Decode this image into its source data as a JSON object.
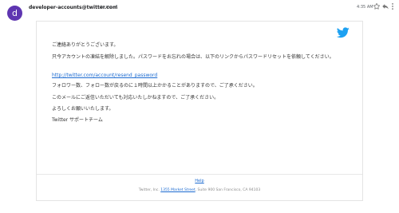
{
  "header": {
    "avatar_letter": "d",
    "sender": "developer-accounts@twitter.com",
    "to": "to me",
    "time": "4:35 AM"
  },
  "icons": {
    "avatar_color": "#5e35b1",
    "brand_bird": "twitter-bird-icon",
    "star": "star-icon",
    "reply": "reply-icon",
    "more": "more-vert-icon"
  },
  "message": {
    "greeting": "ご連絡ありがとうございます。",
    "paragraph1": "只今アカウントの凍結を解除しました。パスワードをお忘れの場合は、以下のリンクからパスワードリセットを依頼してください。",
    "reset_link": "http://twitter.com/account/resend_password",
    "paragraph2": "フォロワー数、フォロー数が戻るのに１時間以上かかることがありますので、ご了承ください。",
    "paragraph3": "このメールにご返信いただいても対応いたしかねますので、ご了承ください。",
    "closing": "よろしくお願いいたします。",
    "signature": "Twitter サポートチーム"
  },
  "footer": {
    "help": "Help",
    "company": "Twitter, Inc.",
    "street": "1355 Market Street",
    "rest": ", Suite 900 San Francisco, CA 94103"
  },
  "colors": {
    "brand_blue": "#1da1f2",
    "link_blue": "#1c6bd1"
  }
}
